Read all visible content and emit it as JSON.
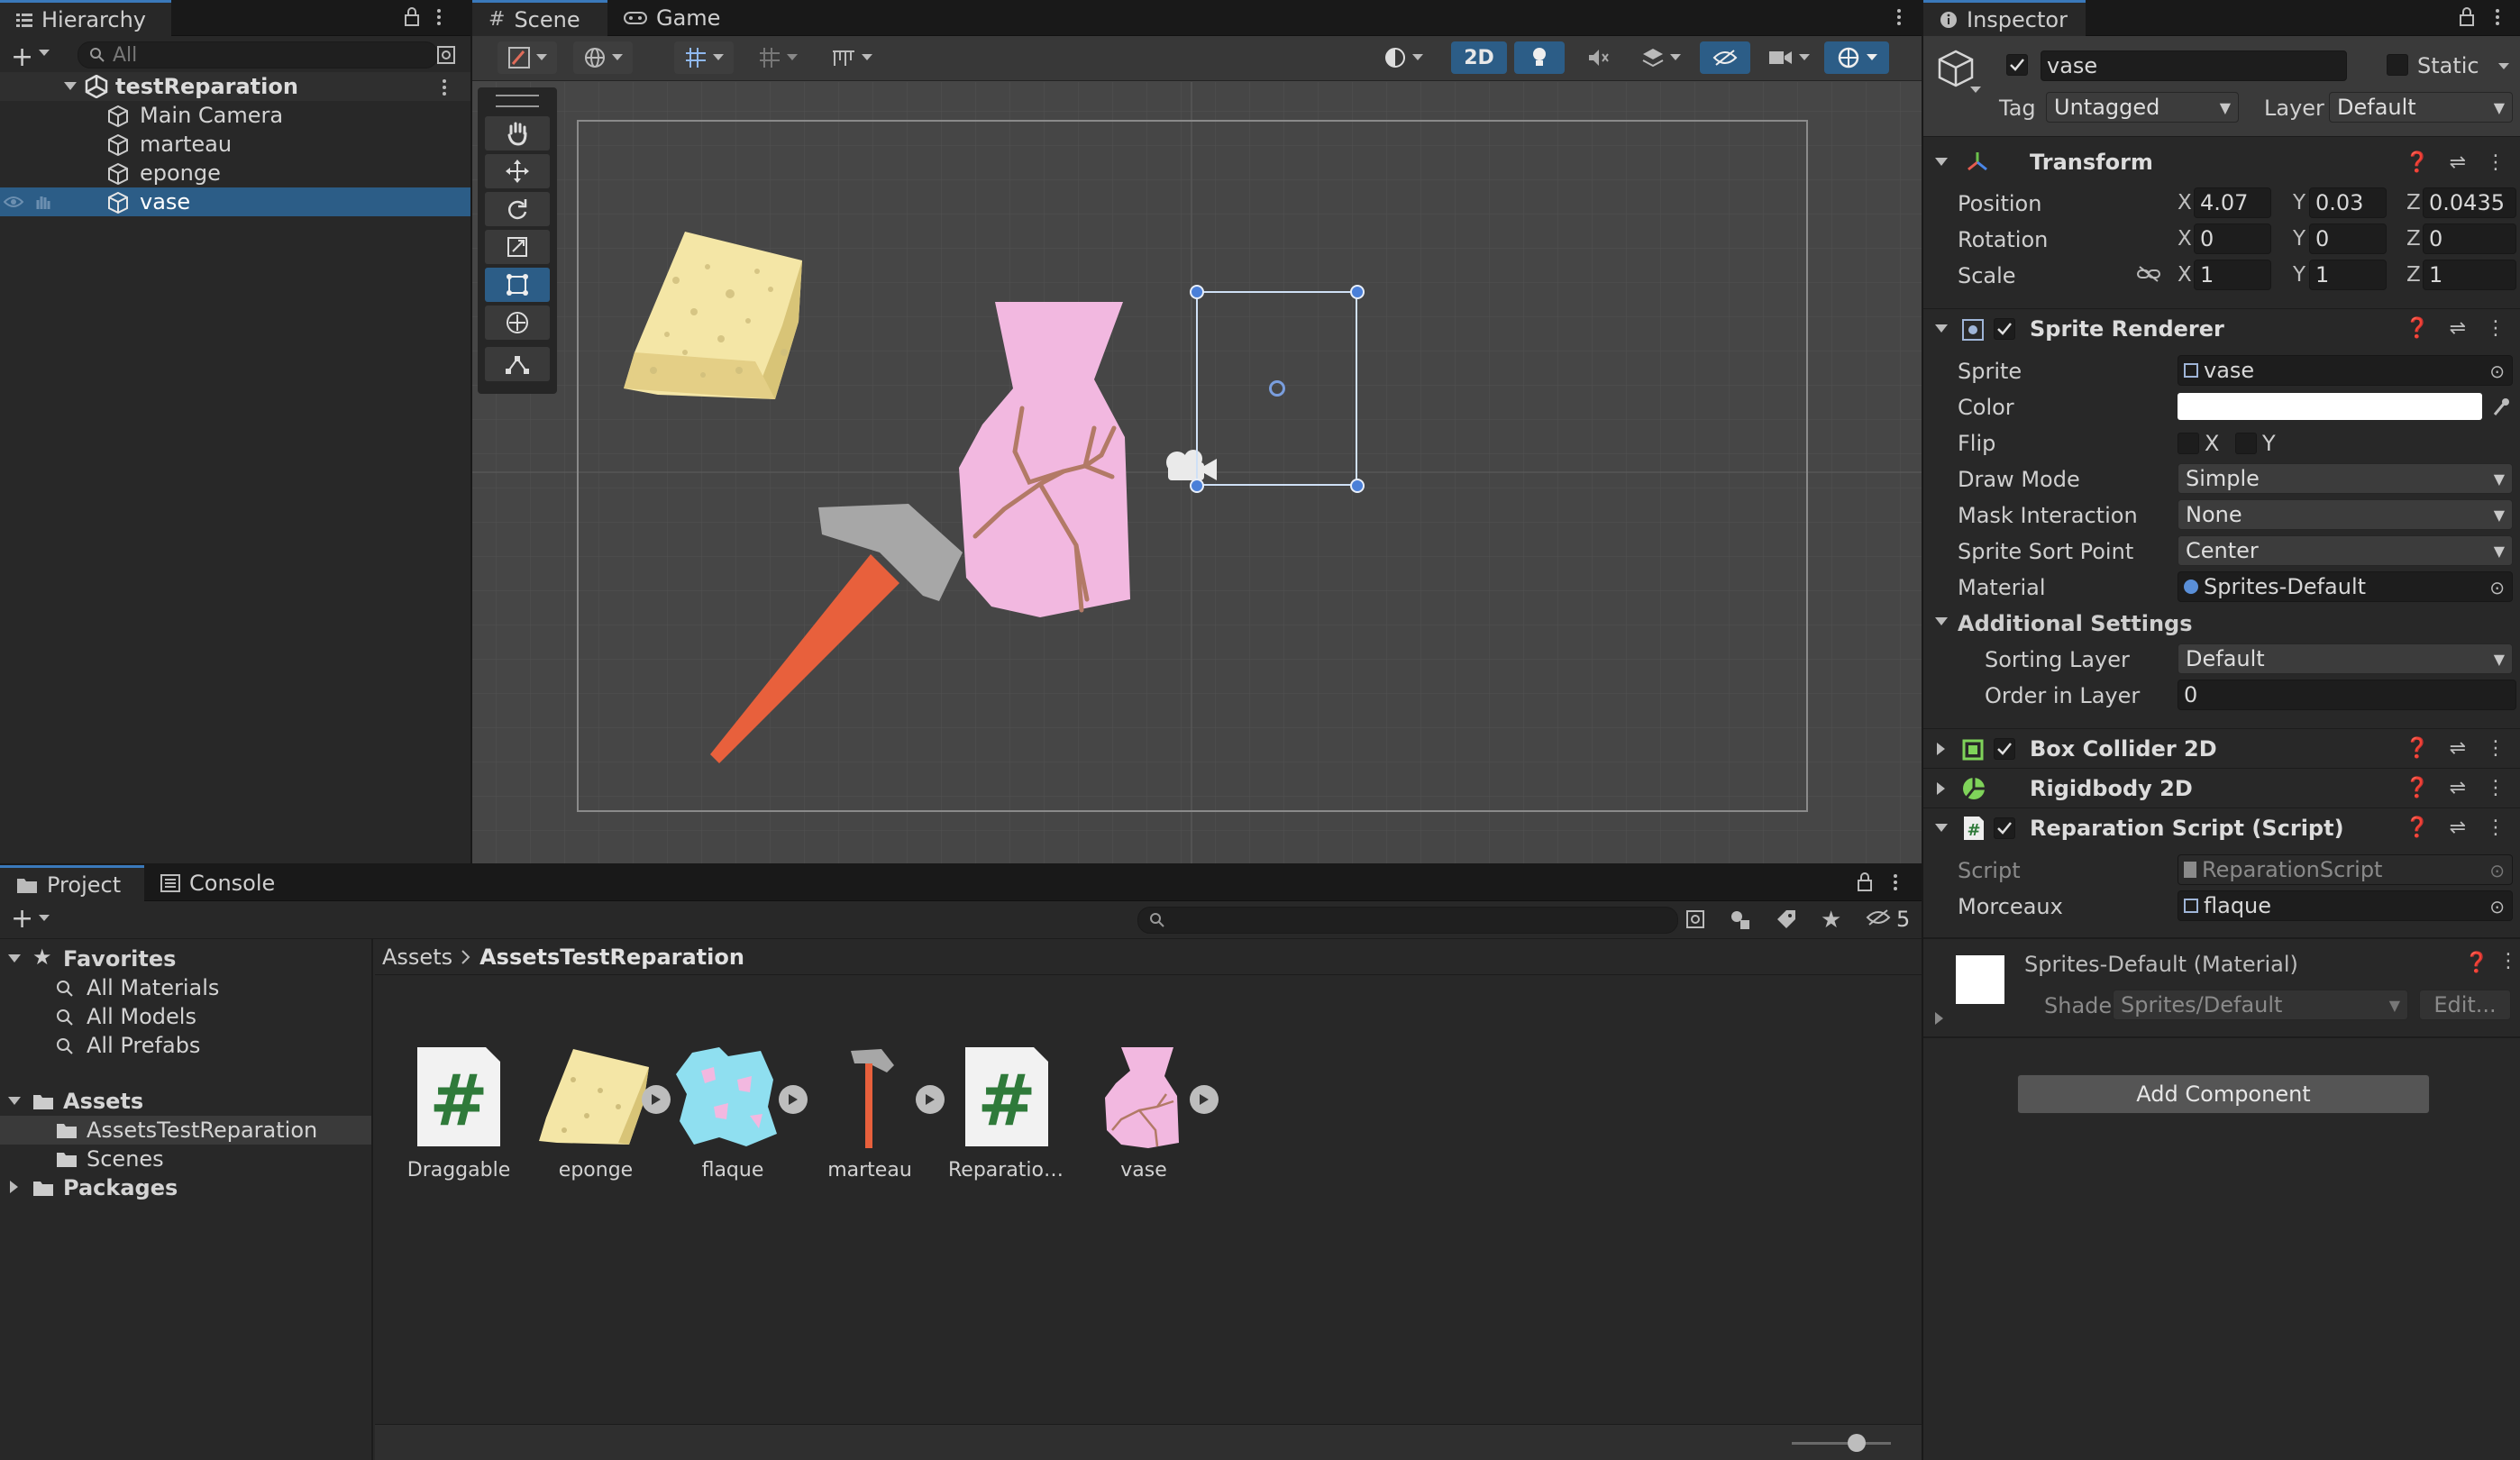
{
  "hierarchy": {
    "tab_label": "Hierarchy",
    "search_placeholder": "All",
    "scene_name": "testReparation",
    "items": [
      "Main Camera",
      "marteau",
      "eponge",
      "vase"
    ],
    "selected_item": "vase"
  },
  "scene_view": {
    "tabs": [
      "Scene",
      "Game"
    ],
    "toggle_2d_label": "2D"
  },
  "project": {
    "tabs": [
      "Project",
      "Console"
    ],
    "hidden_count": "5",
    "favorites": {
      "label": "Favorites",
      "items": [
        "All Materials",
        "All Models",
        "All Prefabs"
      ]
    },
    "assets_root": "Assets",
    "asset_folders": [
      "AssetsTestReparation",
      "Scenes"
    ],
    "packages": "Packages",
    "breadcrumb": [
      "Assets",
      "AssetsTestReparation"
    ],
    "files": [
      {
        "name": "Draggable",
        "icon": "script-icon"
      },
      {
        "name": "eponge",
        "icon": "sponge-thumbnail"
      },
      {
        "name": "flaque",
        "icon": "puddle-thumbnail"
      },
      {
        "name": "marteau",
        "icon": "hammer-thumbnail"
      },
      {
        "name": "Reparation...",
        "icon": "script-icon"
      },
      {
        "name": "vase",
        "icon": "vase-thumbnail"
      }
    ]
  },
  "inspector": {
    "tab_label": "Inspector",
    "object_name": "vase",
    "static_label": "Static",
    "tag_label": "Tag",
    "tag_value": "Untagged",
    "layer_label": "Layer",
    "layer_value": "Default",
    "transform": {
      "title": "Transform",
      "position_label": "Position",
      "rotation_label": "Rotation",
      "scale_label": "Scale",
      "position": {
        "x": "4.07",
        "y": "0.03",
        "z": "0.0435"
      },
      "rotation": {
        "x": "0",
        "y": "0",
        "z": "0"
      },
      "scale": {
        "x": "1",
        "y": "1",
        "z": "1"
      },
      "axis_x": "X",
      "axis_y": "Y",
      "axis_z": "Z"
    },
    "sprite_renderer": {
      "title": "Sprite Renderer",
      "sprite_label": "Sprite",
      "sprite_value": "vase",
      "color_label": "Color",
      "color_value": "#ffffff",
      "flip_label": "Flip",
      "flip_x": "X",
      "flip_y": "Y",
      "draw_mode_label": "Draw Mode",
      "draw_mode_value": "Simple",
      "mask_label": "Mask Interaction",
      "mask_value": "None",
      "sort_point_label": "Sprite Sort Point",
      "sort_point_value": "Center",
      "material_label": "Material",
      "material_value": "Sprites-Default",
      "additional_label": "Additional Settings",
      "sorting_layer_label": "Sorting Layer",
      "sorting_layer_value": "Default",
      "order_label": "Order in Layer",
      "order_value": "0"
    },
    "box_collider": {
      "title": "Box Collider 2D"
    },
    "rigidbody": {
      "title": "Rigidbody 2D"
    },
    "reparation_script": {
      "title": "Reparation Script (Script)",
      "script_label": "Script",
      "script_value": "ReparationScript",
      "morceaux_label": "Morceaux",
      "morceaux_value": "flaque"
    },
    "material_block": {
      "title": "Sprites-Default (Material)",
      "shader_label": "Shader",
      "shader_value": "Sprites/Default",
      "edit_label": "Edit..."
    },
    "add_component_label": "Add Component"
  },
  "colors": {
    "accent_blue": "#3a79bb",
    "selection": "#2c5d87",
    "vase_pink": "#f2b8e0",
    "hammer_orange": "#e8603c",
    "hammer_head": "#a7a7a7",
    "sponge_yellow": "#f4e6a6",
    "gizmo_blue": "#4a7fd8"
  }
}
